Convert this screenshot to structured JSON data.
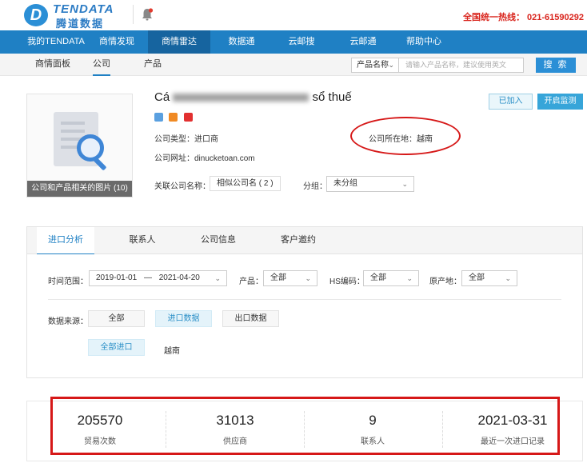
{
  "brand": {
    "name_en": "TENDATA",
    "name_cn": "腾道数据",
    "logo_letter": "D"
  },
  "header": {
    "hotline": "全国统一热线：  021-61590292"
  },
  "nav": {
    "items": [
      "我的TENDATA",
      "商情发现",
      "商情雷达",
      "数据通",
      "云邮搜",
      "云邮通",
      "帮助中心"
    ],
    "active_index": 2
  },
  "subnav": {
    "items": [
      "商情面板",
      "公司",
      "产品"
    ],
    "active_index": 1,
    "search_category": "产品名称",
    "search_placeholder": "请输入产品名称，建议使用英文",
    "search_button": "搜 索"
  },
  "company": {
    "name_visible_prefix": "Cá",
    "name_visible_suffix": "sổ thuế",
    "photo_caption": "公司和产品相关的图片 (10)",
    "type_label": "公司类型：进口商",
    "location_label": "公司所在地：越南",
    "website_label": "公司网址：",
    "website_value": "dinucketoan.com",
    "related_label": "关联公司名称：",
    "related_value": "相似公司名 ( 2 )",
    "group_label": "分组：",
    "group_value": "未分组",
    "joined_button": "已加入",
    "monitor_button": "开启监测"
  },
  "tabs": {
    "items": [
      "进口分析",
      "联系人",
      "公司信息",
      "客户邀约"
    ],
    "active_index": 0
  },
  "filters": {
    "time_label": "时间范围：",
    "time_start": "2019-01-01",
    "time_sep": "—",
    "time_end": "2021-04-20",
    "product_label": "产品：",
    "product_value": "全部",
    "hs_label": "HS编码：",
    "hs_value": "全部",
    "origin_label": "原产地：",
    "origin_value": "全部",
    "source_label": "数据来源：",
    "source_buttons": [
      "全部",
      "进口数据",
      "出口数据"
    ],
    "source_active_index": 1,
    "import_all": "全部进口",
    "import_country": "越南"
  },
  "stats": [
    {
      "value": "205570",
      "label": "贸易次数"
    },
    {
      "value": "31013",
      "label": "供应商"
    },
    {
      "value": "9",
      "label": "联系人"
    },
    {
      "value": "2021-03-31",
      "label": "最近一次进口记录"
    }
  ],
  "colors": {
    "nav_bg": "#1f80c4",
    "accent": "#2b8fd6",
    "annotation_red": "#d61818",
    "hotline_red": "#d9251d"
  }
}
